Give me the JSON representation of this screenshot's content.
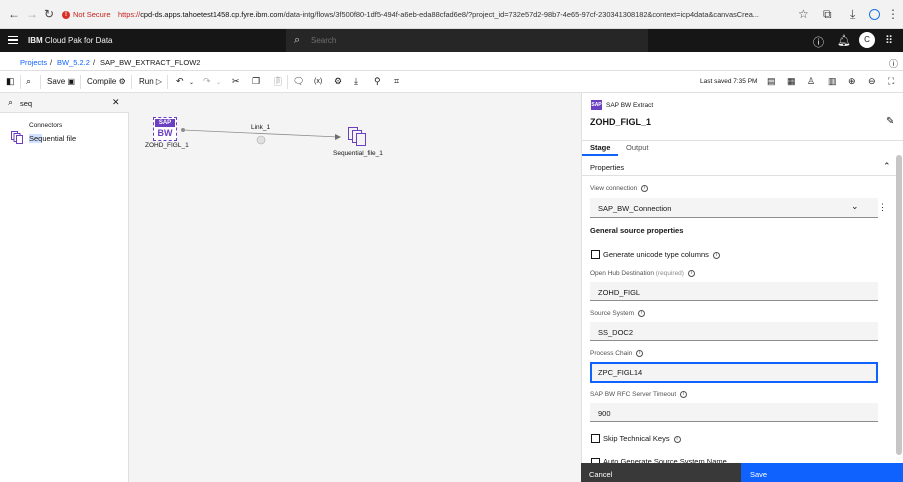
{
  "browser": {
    "not_secure": "Not Secure",
    "url_scheme": "https://",
    "url_domain": "cpd-ds.apps.tahoetest1458.cp.fyre.ibm.com",
    "url_path": "/data-intg/flows/3f500f80-1df5-494f-a6eb-eda88cfad6e8/?project_id=732e57d2-98b7-4e65-97cf-230341308182&context=icp4data&canvasCrea..."
  },
  "header": {
    "brand_ibm": "IBM",
    "brand_rest": "Cloud Pak for Data",
    "search_placeholder": "Search",
    "user_initial": "C"
  },
  "breadcrumb": {
    "items": [
      "Projects",
      "BW_5.2.2"
    ],
    "current": "SAP_BW_EXTRACT_FLOW2"
  },
  "toolbar": {
    "save": "Save",
    "compile": "Compile",
    "run": "Run",
    "last_saved": "Last saved 7:35 PM"
  },
  "palette": {
    "search_value": "seq",
    "group": "Connectors",
    "item_match": "Seq",
    "item_rest": "uential file"
  },
  "canvas": {
    "node1_label": "ZOHD_FIGL_1",
    "node1_icon_text": "SAP BW",
    "link_label": "Link_1",
    "node2_label": "Sequential_file_1"
  },
  "props": {
    "stage_type": "SAP BW Extract",
    "stage_name": "ZOHD_FIGL_1",
    "tabs": [
      "Stage",
      "Output"
    ],
    "section": "Properties",
    "view_connection_label": "View connection",
    "connection_value": "SAP_BW_Connection",
    "general_heading": "General source properties",
    "unicode_label": "Generate unicode type columns",
    "ohd_label": "Open Hub Destination",
    "ohd_required": "(required)",
    "ohd_value": "ZOHD_FIGL",
    "source_system_label": "Source System",
    "source_system_value": "SS_DOC2",
    "process_chain_label": "Process Chain",
    "process_chain_value": "ZPC_FIGL14",
    "timeout_label": "SAP BW RFC Server Timeout",
    "timeout_value": "900",
    "skip_keys_label": "Skip Technical Keys",
    "auto_gen_label": "Auto Generate Source System Name",
    "cancel": "Cancel",
    "save": "Save"
  },
  "colors": {
    "accent": "#0f62fe",
    "header_bg": "#161616",
    "canvas_bg": "#f4f4f4",
    "sap_purple": "#6b3fc1"
  }
}
